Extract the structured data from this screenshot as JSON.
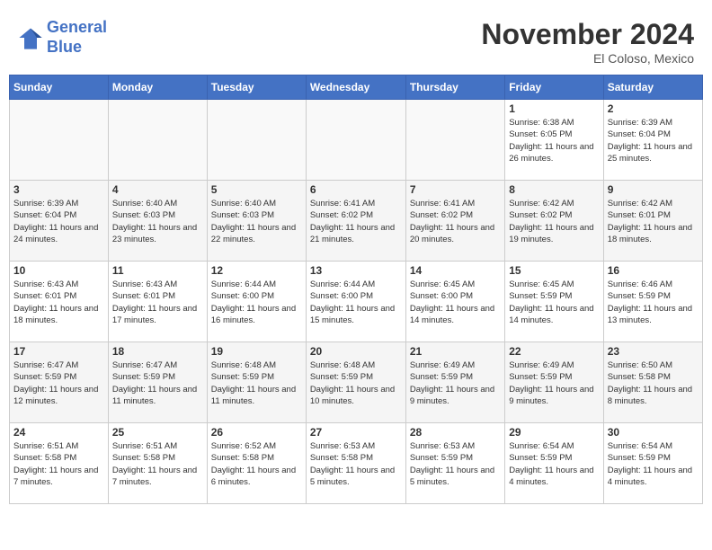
{
  "header": {
    "logo_line1": "General",
    "logo_line2": "Blue",
    "month_title": "November 2024",
    "location": "El Coloso, Mexico"
  },
  "weekdays": [
    "Sunday",
    "Monday",
    "Tuesday",
    "Wednesday",
    "Thursday",
    "Friday",
    "Saturday"
  ],
  "weeks": [
    [
      {
        "day": "",
        "sunrise": "",
        "sunset": "",
        "daylight": ""
      },
      {
        "day": "",
        "sunrise": "",
        "sunset": "",
        "daylight": ""
      },
      {
        "day": "",
        "sunrise": "",
        "sunset": "",
        "daylight": ""
      },
      {
        "day": "",
        "sunrise": "",
        "sunset": "",
        "daylight": ""
      },
      {
        "day": "",
        "sunrise": "",
        "sunset": "",
        "daylight": ""
      },
      {
        "day": "1",
        "sunrise": "Sunrise: 6:38 AM",
        "sunset": "Sunset: 6:05 PM",
        "daylight": "Daylight: 11 hours and 26 minutes."
      },
      {
        "day": "2",
        "sunrise": "Sunrise: 6:39 AM",
        "sunset": "Sunset: 6:04 PM",
        "daylight": "Daylight: 11 hours and 25 minutes."
      }
    ],
    [
      {
        "day": "3",
        "sunrise": "Sunrise: 6:39 AM",
        "sunset": "Sunset: 6:04 PM",
        "daylight": "Daylight: 11 hours and 24 minutes."
      },
      {
        "day": "4",
        "sunrise": "Sunrise: 6:40 AM",
        "sunset": "Sunset: 6:03 PM",
        "daylight": "Daylight: 11 hours and 23 minutes."
      },
      {
        "day": "5",
        "sunrise": "Sunrise: 6:40 AM",
        "sunset": "Sunset: 6:03 PM",
        "daylight": "Daylight: 11 hours and 22 minutes."
      },
      {
        "day": "6",
        "sunrise": "Sunrise: 6:41 AM",
        "sunset": "Sunset: 6:02 PM",
        "daylight": "Daylight: 11 hours and 21 minutes."
      },
      {
        "day": "7",
        "sunrise": "Sunrise: 6:41 AM",
        "sunset": "Sunset: 6:02 PM",
        "daylight": "Daylight: 11 hours and 20 minutes."
      },
      {
        "day": "8",
        "sunrise": "Sunrise: 6:42 AM",
        "sunset": "Sunset: 6:02 PM",
        "daylight": "Daylight: 11 hours and 19 minutes."
      },
      {
        "day": "9",
        "sunrise": "Sunrise: 6:42 AM",
        "sunset": "Sunset: 6:01 PM",
        "daylight": "Daylight: 11 hours and 18 minutes."
      }
    ],
    [
      {
        "day": "10",
        "sunrise": "Sunrise: 6:43 AM",
        "sunset": "Sunset: 6:01 PM",
        "daylight": "Daylight: 11 hours and 18 minutes."
      },
      {
        "day": "11",
        "sunrise": "Sunrise: 6:43 AM",
        "sunset": "Sunset: 6:01 PM",
        "daylight": "Daylight: 11 hours and 17 minutes."
      },
      {
        "day": "12",
        "sunrise": "Sunrise: 6:44 AM",
        "sunset": "Sunset: 6:00 PM",
        "daylight": "Daylight: 11 hours and 16 minutes."
      },
      {
        "day": "13",
        "sunrise": "Sunrise: 6:44 AM",
        "sunset": "Sunset: 6:00 PM",
        "daylight": "Daylight: 11 hours and 15 minutes."
      },
      {
        "day": "14",
        "sunrise": "Sunrise: 6:45 AM",
        "sunset": "Sunset: 6:00 PM",
        "daylight": "Daylight: 11 hours and 14 minutes."
      },
      {
        "day": "15",
        "sunrise": "Sunrise: 6:45 AM",
        "sunset": "Sunset: 5:59 PM",
        "daylight": "Daylight: 11 hours and 14 minutes."
      },
      {
        "day": "16",
        "sunrise": "Sunrise: 6:46 AM",
        "sunset": "Sunset: 5:59 PM",
        "daylight": "Daylight: 11 hours and 13 minutes."
      }
    ],
    [
      {
        "day": "17",
        "sunrise": "Sunrise: 6:47 AM",
        "sunset": "Sunset: 5:59 PM",
        "daylight": "Daylight: 11 hours and 12 minutes."
      },
      {
        "day": "18",
        "sunrise": "Sunrise: 6:47 AM",
        "sunset": "Sunset: 5:59 PM",
        "daylight": "Daylight: 11 hours and 11 minutes."
      },
      {
        "day": "19",
        "sunrise": "Sunrise: 6:48 AM",
        "sunset": "Sunset: 5:59 PM",
        "daylight": "Daylight: 11 hours and 11 minutes."
      },
      {
        "day": "20",
        "sunrise": "Sunrise: 6:48 AM",
        "sunset": "Sunset: 5:59 PM",
        "daylight": "Daylight: 11 hours and 10 minutes."
      },
      {
        "day": "21",
        "sunrise": "Sunrise: 6:49 AM",
        "sunset": "Sunset: 5:59 PM",
        "daylight": "Daylight: 11 hours and 9 minutes."
      },
      {
        "day": "22",
        "sunrise": "Sunrise: 6:49 AM",
        "sunset": "Sunset: 5:59 PM",
        "daylight": "Daylight: 11 hours and 9 minutes."
      },
      {
        "day": "23",
        "sunrise": "Sunrise: 6:50 AM",
        "sunset": "Sunset: 5:58 PM",
        "daylight": "Daylight: 11 hours and 8 minutes."
      }
    ],
    [
      {
        "day": "24",
        "sunrise": "Sunrise: 6:51 AM",
        "sunset": "Sunset: 5:58 PM",
        "daylight": "Daylight: 11 hours and 7 minutes."
      },
      {
        "day": "25",
        "sunrise": "Sunrise: 6:51 AM",
        "sunset": "Sunset: 5:58 PM",
        "daylight": "Daylight: 11 hours and 7 minutes."
      },
      {
        "day": "26",
        "sunrise": "Sunrise: 6:52 AM",
        "sunset": "Sunset: 5:58 PM",
        "daylight": "Daylight: 11 hours and 6 minutes."
      },
      {
        "day": "27",
        "sunrise": "Sunrise: 6:53 AM",
        "sunset": "Sunset: 5:58 PM",
        "daylight": "Daylight: 11 hours and 5 minutes."
      },
      {
        "day": "28",
        "sunrise": "Sunrise: 6:53 AM",
        "sunset": "Sunset: 5:59 PM",
        "daylight": "Daylight: 11 hours and 5 minutes."
      },
      {
        "day": "29",
        "sunrise": "Sunrise: 6:54 AM",
        "sunset": "Sunset: 5:59 PM",
        "daylight": "Daylight: 11 hours and 4 minutes."
      },
      {
        "day": "30",
        "sunrise": "Sunrise: 6:54 AM",
        "sunset": "Sunset: 5:59 PM",
        "daylight": "Daylight: 11 hours and 4 minutes."
      }
    ]
  ]
}
